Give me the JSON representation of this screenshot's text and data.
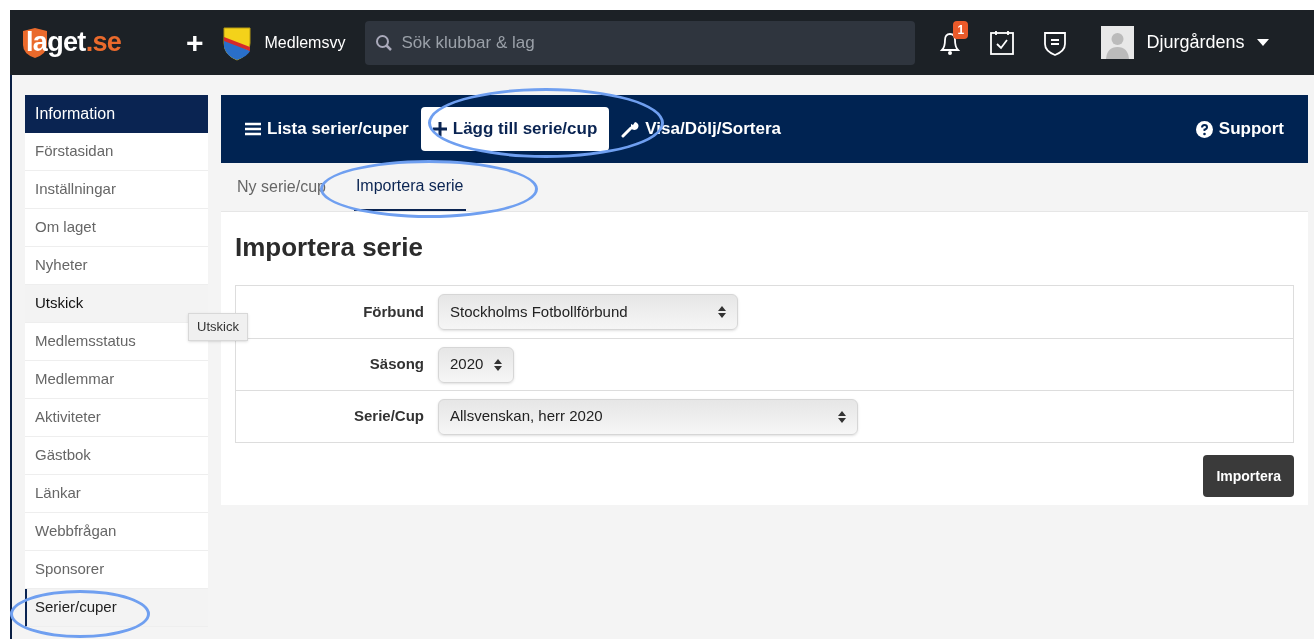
{
  "topbar": {
    "logo": {
      "text": "laget",
      "suffix": ".se"
    },
    "add": "+",
    "team": "Medlemsvy",
    "search": {
      "placeholder": "Sök klubbar & lag"
    },
    "notifications": "1",
    "user": "Djurgårdens"
  },
  "sidebar": {
    "header": "Information",
    "items": [
      {
        "label": "Förstasidan",
        "selected": false,
        "hovered": false
      },
      {
        "label": "Inställningar",
        "selected": false,
        "hovered": false
      },
      {
        "label": "Om laget",
        "selected": false,
        "hovered": false
      },
      {
        "label": "Nyheter",
        "selected": false,
        "hovered": false
      },
      {
        "label": "Utskick",
        "selected": false,
        "hovered": true
      },
      {
        "label": "Medlemsstatus",
        "selected": false,
        "hovered": false
      },
      {
        "label": "Medlemmar",
        "selected": false,
        "hovered": false
      },
      {
        "label": "Aktiviteter",
        "selected": false,
        "hovered": false
      },
      {
        "label": "Gästbok",
        "selected": false,
        "hovered": false
      },
      {
        "label": "Länkar",
        "selected": false,
        "hovered": false
      },
      {
        "label": "Webbfrågan",
        "selected": false,
        "hovered": false
      },
      {
        "label": "Sponsorer",
        "selected": false,
        "hovered": false
      },
      {
        "label": "Serier/cuper",
        "selected": true,
        "hovered": false
      }
    ],
    "tooltip": "Utskick"
  },
  "toolbar": {
    "items": [
      {
        "kind": "list",
        "label": "Lista serier/cuper",
        "selected": false
      },
      {
        "kind": "add",
        "label": "Lägg till serie/cup",
        "selected": true
      },
      {
        "kind": "wrench",
        "label": "Visa/Dölj/Sortera",
        "selected": false
      }
    ],
    "support": "Support"
  },
  "subtabs": [
    {
      "label": "Ny serie/cup",
      "selected": false
    },
    {
      "label": "Importera serie",
      "selected": true
    }
  ],
  "heading": "Importera serie",
  "form": [
    {
      "label": "Förbund",
      "value": "Stockholms Fotbollförbund",
      "kind": "wide"
    },
    {
      "label": "Säsong",
      "value": "2020",
      "kind": "narrow"
    },
    {
      "label": "Serie/Cup",
      "value": "Allsvenskan, herr 2020",
      "kind": "xwide"
    }
  ],
  "submit": "Importera"
}
